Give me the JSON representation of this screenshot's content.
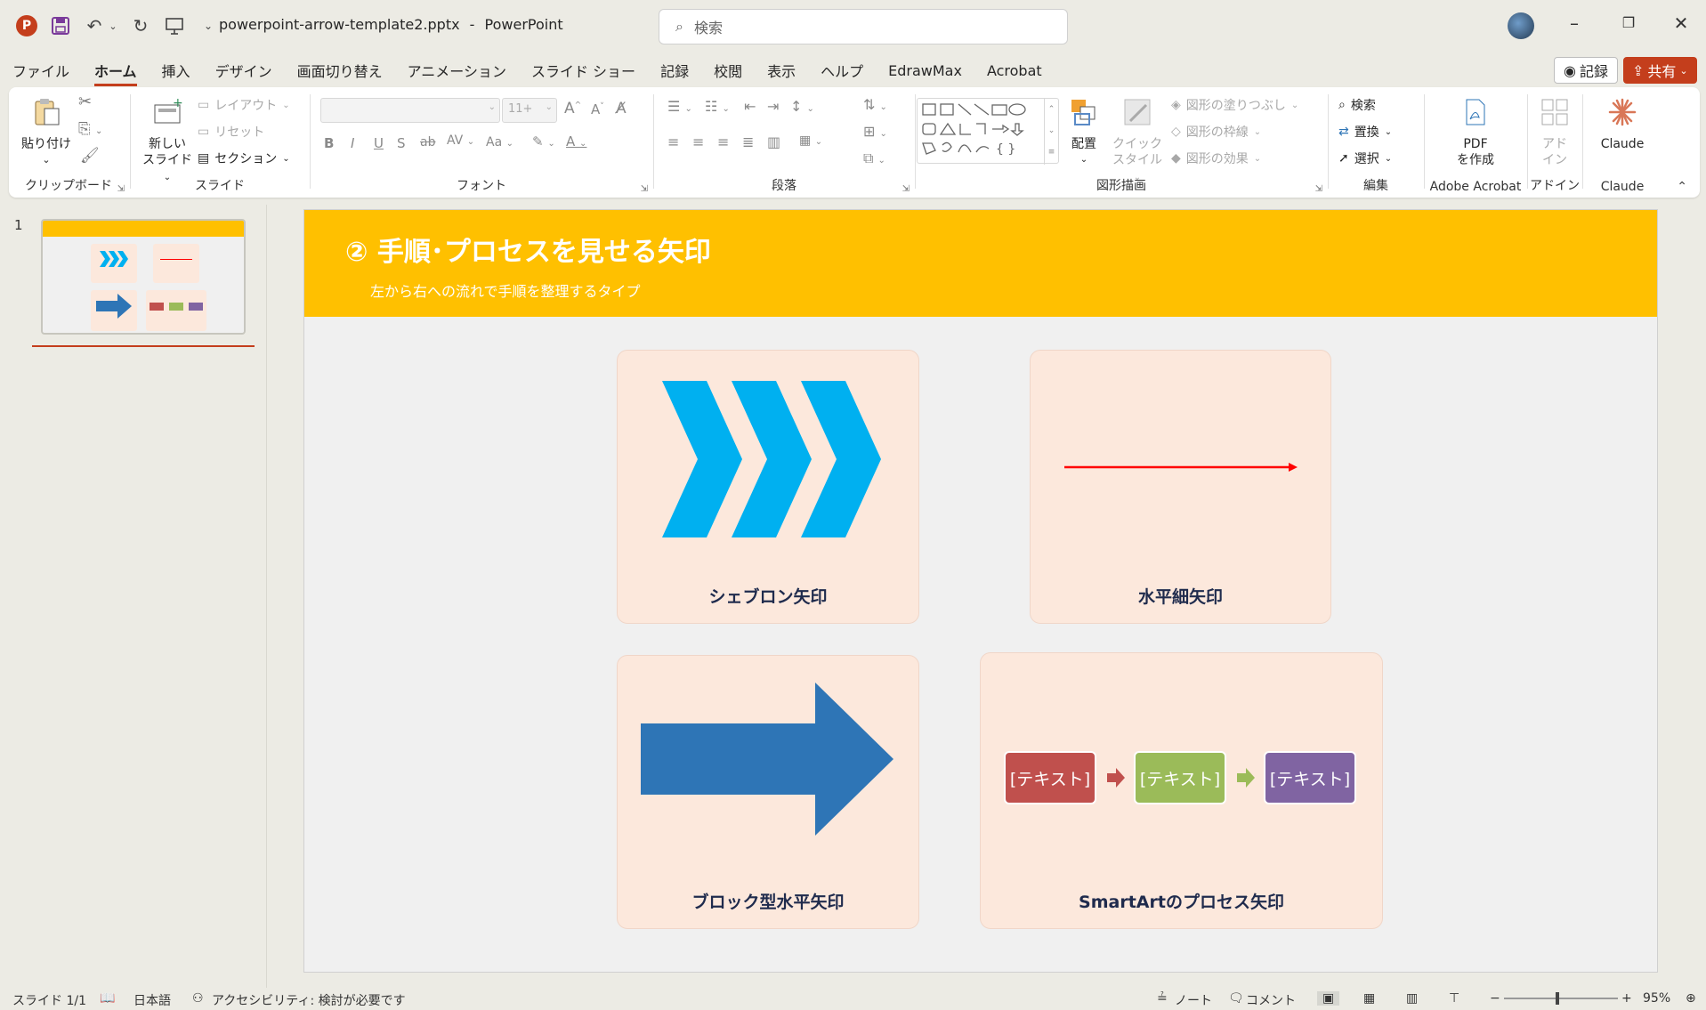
{
  "titlebar": {
    "file_name": "powerpoint-arrow-template2.pptx",
    "separator": "-",
    "app_name": "PowerPoint",
    "search_placeholder": "検索",
    "app_logo": "P"
  },
  "menu": {
    "tabs": [
      "ファイル",
      "ホーム",
      "挿入",
      "デザイン",
      "画面切り替え",
      "アニメーション",
      "スライド ショー",
      "記録",
      "校閲",
      "表示",
      "ヘルプ",
      "EdrawMax",
      "Acrobat"
    ],
    "active_tab": "ホーム",
    "record_label": "記録",
    "share_label": "共有"
  },
  "ribbon": {
    "clipboard": {
      "paste": "貼り付け",
      "label": "クリップボード"
    },
    "slides": {
      "new_slide_1": "新しい",
      "new_slide_2": "スライド",
      "layout": "レイアウト",
      "reset": "リセット",
      "section": "セクション",
      "label": "スライド"
    },
    "font": {
      "size": "11+",
      "label": "フォント"
    },
    "paragraph": {
      "label": "段落"
    },
    "drawing": {
      "arrange": "配置",
      "quick_style_1": "クイック",
      "quick_style_2": "スタイル",
      "fill": "図形の塗りつぶし",
      "outline": "図形の枠線",
      "effects": "図形の効果",
      "label": "図形描画"
    },
    "editing": {
      "find": "検索",
      "replace": "置換",
      "select": "選択",
      "label": "編集"
    },
    "acrobat": {
      "pdf_1": "PDF",
      "pdf_2": "を作成",
      "label": "Adobe Acrobat"
    },
    "addins": {
      "addin_1": "アド",
      "addin_2": "イン",
      "label": "アドイン"
    },
    "claude": {
      "name": "Claude",
      "label": "Claude"
    }
  },
  "thumbnails": {
    "slide_number": "1"
  },
  "slide": {
    "title": "② 手順･プロセスを見せる矢印",
    "subtitle": "左から右への流れで手順を整理するタイプ",
    "cards": [
      {
        "label": "シェブロン矢印"
      },
      {
        "label": "水平細矢印"
      },
      {
        "label": "ブロック型水平矢印"
      },
      {
        "label": "SmartArtのプロセス矢印"
      }
    ],
    "smartart_boxes": [
      "[テキスト]",
      "[テキスト]",
      "[テキスト]"
    ],
    "colors": {
      "header": "#ffc000",
      "chevron": "#00b0f0",
      "thin_arrow": "#ff0000",
      "block_arrow": "#2e75b6",
      "smartart_1": "#c0504d",
      "smartart_2": "#9bbb59",
      "smartart_3": "#8064a2",
      "card_bg": "#fce8dc"
    }
  },
  "status": {
    "slide_info": "スライド 1/1",
    "language": "日本語",
    "accessibility": "アクセシビリティ: 検討が必要です",
    "notes": "ノート",
    "comments": "コメント",
    "zoom": "95%"
  }
}
